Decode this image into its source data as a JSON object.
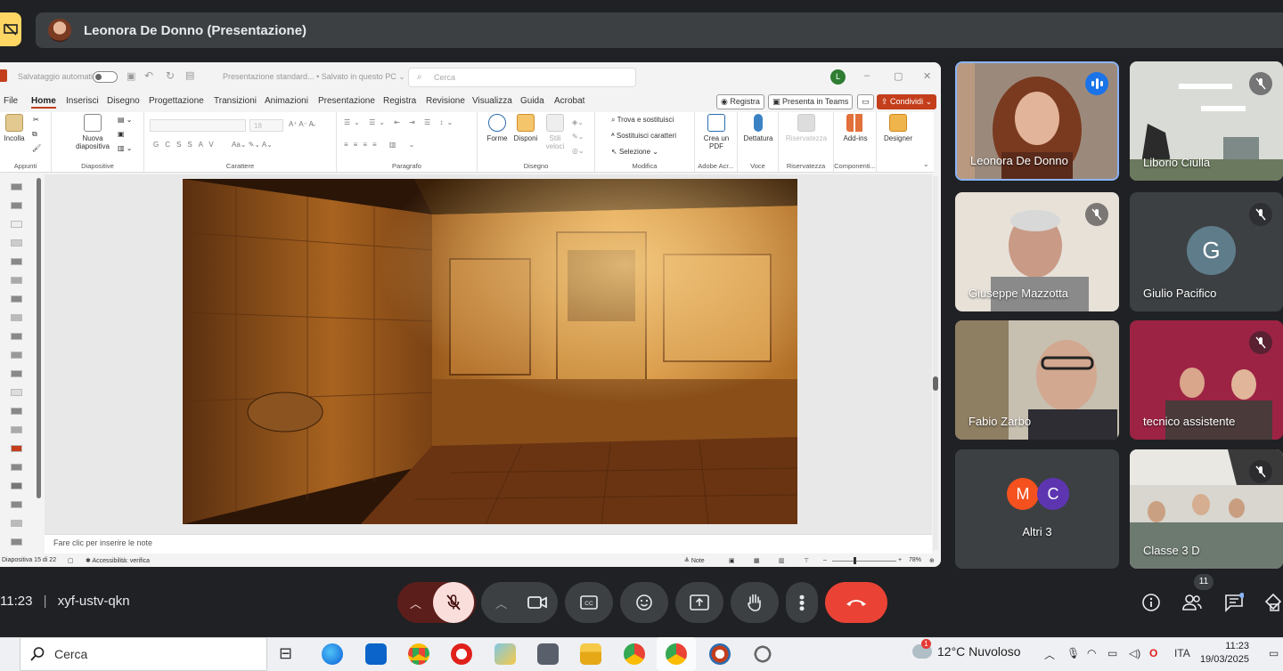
{
  "presenter": {
    "name": "Leonora De Donno (Presentazione)"
  },
  "powerpoint": {
    "autosave_label": "Salvataggio automatico",
    "doc_title": "Presentazione standard... • Salvato in questo PC ⌄",
    "search_placeholder": "Cerca",
    "user_initial": "L",
    "tabs": [
      "File",
      "Home",
      "Inserisci",
      "Disegno",
      "Progettazione",
      "Transizioni",
      "Animazioni",
      "Presentazione",
      "Registra",
      "Revisione",
      "Visualizza",
      "Guida",
      "Acrobat"
    ],
    "record_button": "Registra",
    "teams_button": "Presenta in Teams",
    "share_button": "Condividi",
    "ribbon": {
      "paste": "Incolla",
      "clipboard_group": "Appunti",
      "new_slide": "Nuova diapositiva",
      "slides_group": "Diapositive",
      "font_group": "Carattere",
      "paragraph_group": "Paragrafo",
      "shapes": "Forme",
      "arrange": "Disponi",
      "quick_styles": "Stili veloci",
      "drawing_group": "Disegno",
      "find_replace": "Trova e sostituisci",
      "replace_fonts": "Sostituisci caratteri",
      "select": "Selezione",
      "editing_group": "Modifica",
      "create_pdf": "Crea un PDF",
      "adobe_group": "Adobe Acr...",
      "dictate": "Dettatura",
      "voice_group": "Voce",
      "sensitivity": "Riservatezza",
      "sensitivity_group": "Riservatezza",
      "addins": "Add-ins",
      "addins_group": "Componenti...",
      "designer": "Designer",
      "font_size": "18"
    },
    "notes_placeholder": "Fare clic per inserire le note",
    "status": {
      "slide_count": "Diapositiva 15 di 22",
      "accessibility": "Accessibilità: verifica",
      "notes": "Note",
      "zoom": "78%"
    }
  },
  "participants": [
    {
      "name": "Leonora De Donno"
    },
    {
      "name": "Liborio Ciulla"
    },
    {
      "name": "Giuseppe Mazzotta"
    },
    {
      "name": "Giulio Pacifico",
      "initial": "G"
    },
    {
      "name": "Fabio Zarbo"
    },
    {
      "name": "tecnico assistente"
    },
    {
      "name": "Altri 3",
      "initials": [
        "M",
        "C"
      ]
    },
    {
      "name": "Classe 3 D"
    }
  ],
  "meeting": {
    "time": "11:23",
    "separator": "|",
    "code": "xyf-ustv-qkn",
    "people_count": "11"
  },
  "taskbar": {
    "search": "Cerca",
    "weather": "12°C  Nuvoloso",
    "weather_badge": "1",
    "language": "ITA",
    "clock_time": "11:23",
    "clock_date": "19/03/2025"
  },
  "colors": {
    "meet_bg": "#202124",
    "tile_bg": "#3c4043",
    "end_call": "#ea4335",
    "mic_off": "#f9dedc",
    "ppt_accent": "#c43e1c",
    "speaking": "#1a73e8"
  }
}
